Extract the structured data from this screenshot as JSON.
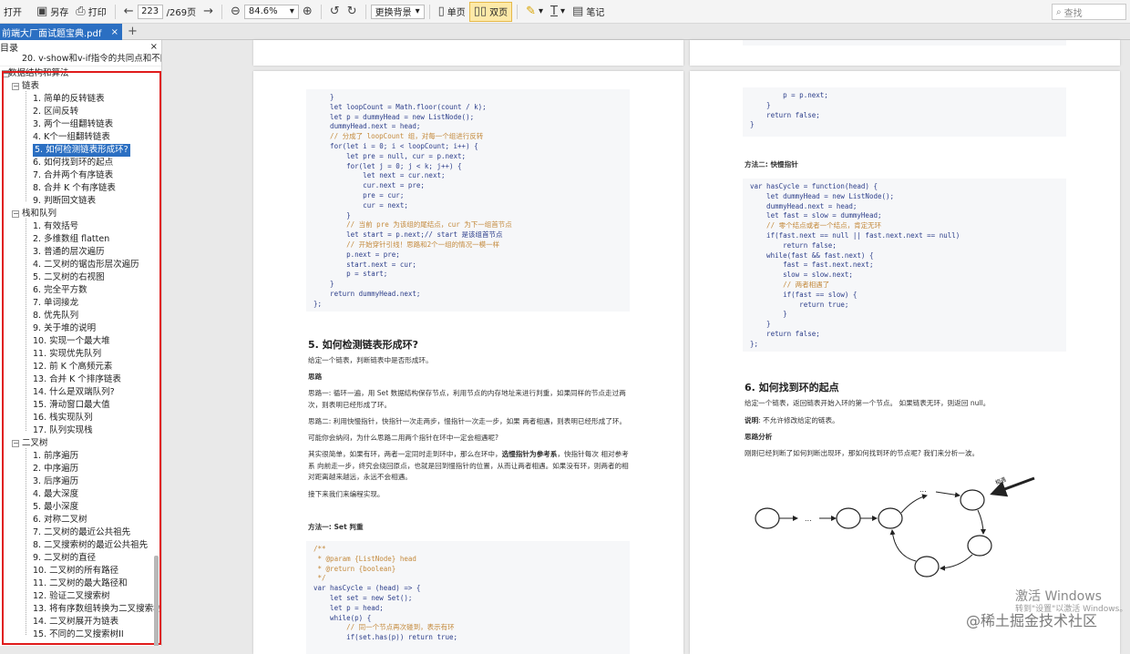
{
  "toolbar": {
    "open": "打开",
    "save_as": "另存",
    "print": "打印",
    "page_current": "223",
    "page_total": "/269页",
    "zoom": "84.6%",
    "background": "更换背景",
    "single": "单页",
    "double": "双页",
    "notes": "笔记",
    "search_placeholder": "查找"
  },
  "tab": {
    "title": "前端大厂面试题宝典.pdf",
    "close": "×",
    "add": "+"
  },
  "sidebar": {
    "title": "目录",
    "close": "×",
    "prev_item": "20. v-show和v-if指令的共同点和不同点",
    "section": "数据结构和算法",
    "groups": [
      {
        "label": "链表",
        "items": [
          "1. 简单的反转链表",
          "2. 区间反转",
          "3. 两个一组翻转链表",
          "4. K个一组翻转链表",
          "5. 如何检测链表形成环?",
          "6. 如何找到环的起点",
          "7. 合并两个有序链表",
          "8. 合并 K 个有序链表",
          "9. 判断回文链表"
        ]
      },
      {
        "label": "栈和队列",
        "items": [
          "1. 有效括号",
          "2. 多维数组 flatten",
          "3. 普通的层次遍历",
          "4. 二叉树的锯齿形层次遍历",
          "5. 二叉树的右视图",
          "6. 完全平方数",
          "7. 单词接龙",
          "8. 优先队列",
          "9. 关于堆的说明",
          "10. 实现一个最大堆",
          "11. 实现优先队列",
          "12. 前 K 个高频元素",
          "13. 合并 K 个排序链表",
          "14. 什么是双端队列?",
          "15. 滑动窗口最大值",
          "16. 栈实现队列",
          "17. 队列实现栈"
        ]
      },
      {
        "label": "二叉树",
        "items": [
          "1. 前序遍历",
          "2. 中序遍历",
          "3. 后序遍历",
          "4. 最大深度",
          "5. 最小深度",
          "6. 对称二叉树",
          "7. 二叉树的最近公共祖先",
          "8. 二叉搜索树的最近公共祖先",
          "9. 二叉树的直径",
          "10. 二叉树的所有路径",
          "11. 二叉树的最大路径和",
          "12. 验证二叉搜索树",
          "13. 将有序数组转换为二叉搜索树",
          "14. 二叉树展开为链表",
          "15. 不同的二叉搜索树II"
        ]
      }
    ],
    "selected": "5. 如何检测链表形成环?"
  },
  "left_page": {
    "code_top": [
      "    }",
      "    let loopCount = Math.floor(count / k);",
      "    let p = dummyHead = new ListNode();",
      "    dummyHead.next = head;",
      "    // 分成了 loopCount 组，对每一个组进行反转",
      "    for(let i = 0; i < loopCount; i++) {",
      "        let pre = null, cur = p.next;",
      "        for(let j = 0; j < k; j++) {",
      "            let next = cur.next;",
      "            cur.next = pre;",
      "            pre = cur;",
      "            cur = next;",
      "        }",
      "        // 当前 pre 为该组的尾结点，cur 为下一组首节点",
      "        let start = p.next;// start 是该组首节点",
      "        // 开始穿针引线！思路和2个一组的情况一模一样",
      "        p.next = pre;",
      "        start.next = cur;",
      "        p = start;",
      "    }",
      "    return dummyHead.next;",
      "};"
    ],
    "heading": "5. 如何检测链表形成环?",
    "p1": "给定一个链表，判断链表中是否形成环。",
    "p_thought": "思路",
    "p2": "思路一: 循环一遍，用 Set 数据结构保存节点，利用节点的内存地址来进行判重，如果同样的节点走过两次，则表明已经形成了环。",
    "p3": "思路二: 利用快慢指针，快指针一次走两步，慢指针一次走一步，如果 两者相遇，则表明已经形成了环。",
    "p4": "可能你会纳闷，为什么思路二用两个指针在环中一定会相遇呢?",
    "p5a": "其实很简单，如果有环，两者一定同时走到环中，那么在环中，",
    "p5b": "选慢指针为参考系",
    "p5c": "，快指针每次 相对参考系 向前走一步，终究会绕回原点，也就是回到慢指针的位置，从而让两者相遇。如果没有环，则两者的相对距离越来越远，永远不会相遇。",
    "p6": "接下来我们来编程实现。",
    "method1": "方法一: Set 判重",
    "code_bottom": [
      "/**",
      " * @param {ListNode} head",
      " * @return {boolean}",
      " */",
      "var hasCycle = (head) => {",
      "    let set = new Set();",
      "    let p = head;",
      "    while(p) {",
      "        // 同一个节点再次碰到，表示有环",
      "        if(set.has(p)) return true;"
    ]
  },
  "right_page": {
    "code_top": [
      "        p = p.next;",
      "    }",
      "    return false;",
      "}"
    ],
    "method2": "方法二: 快慢指针",
    "code_mid": [
      "var hasCycle = function(head) {",
      "    let dummyHead = new ListNode();",
      "    dummyHead.next = head;",
      "    let fast = slow = dummyHead;",
      "    // 零个结点或者一个结点，肯定无环",
      "    if(fast.next == null || fast.next.next == null)",
      "        return false;",
      "    while(fast && fast.next) {",
      "        fast = fast.next.next;",
      "        slow = slow.next;",
      "        // 两者相遇了",
      "        if(fast == slow) {",
      "            return true;",
      "        }",
      "    }",
      "    return false;",
      "};"
    ],
    "heading": "6. 如何找到环的起点",
    "p1": "给定一个链表，返回链表开始入环的第一个节点。 如果链表无环，则返回 null。",
    "p2a": "说明",
    "p2b": ": 不允许修改给定的链表。",
    "p3": "思路分析",
    "p4": "刚刚已经判断了如何判断出现环，那如何找到环的节点呢? 我们来分析一波。",
    "diagram_dots1": "...",
    "diagram_dots2": "...",
    "diagram_label": "相遇"
  },
  "watermark": {
    "activate": "激活 Windows",
    "activate_sub": "转到\"设置\"以激活 Windows。",
    "site": "@稀土掘金技术社区"
  }
}
